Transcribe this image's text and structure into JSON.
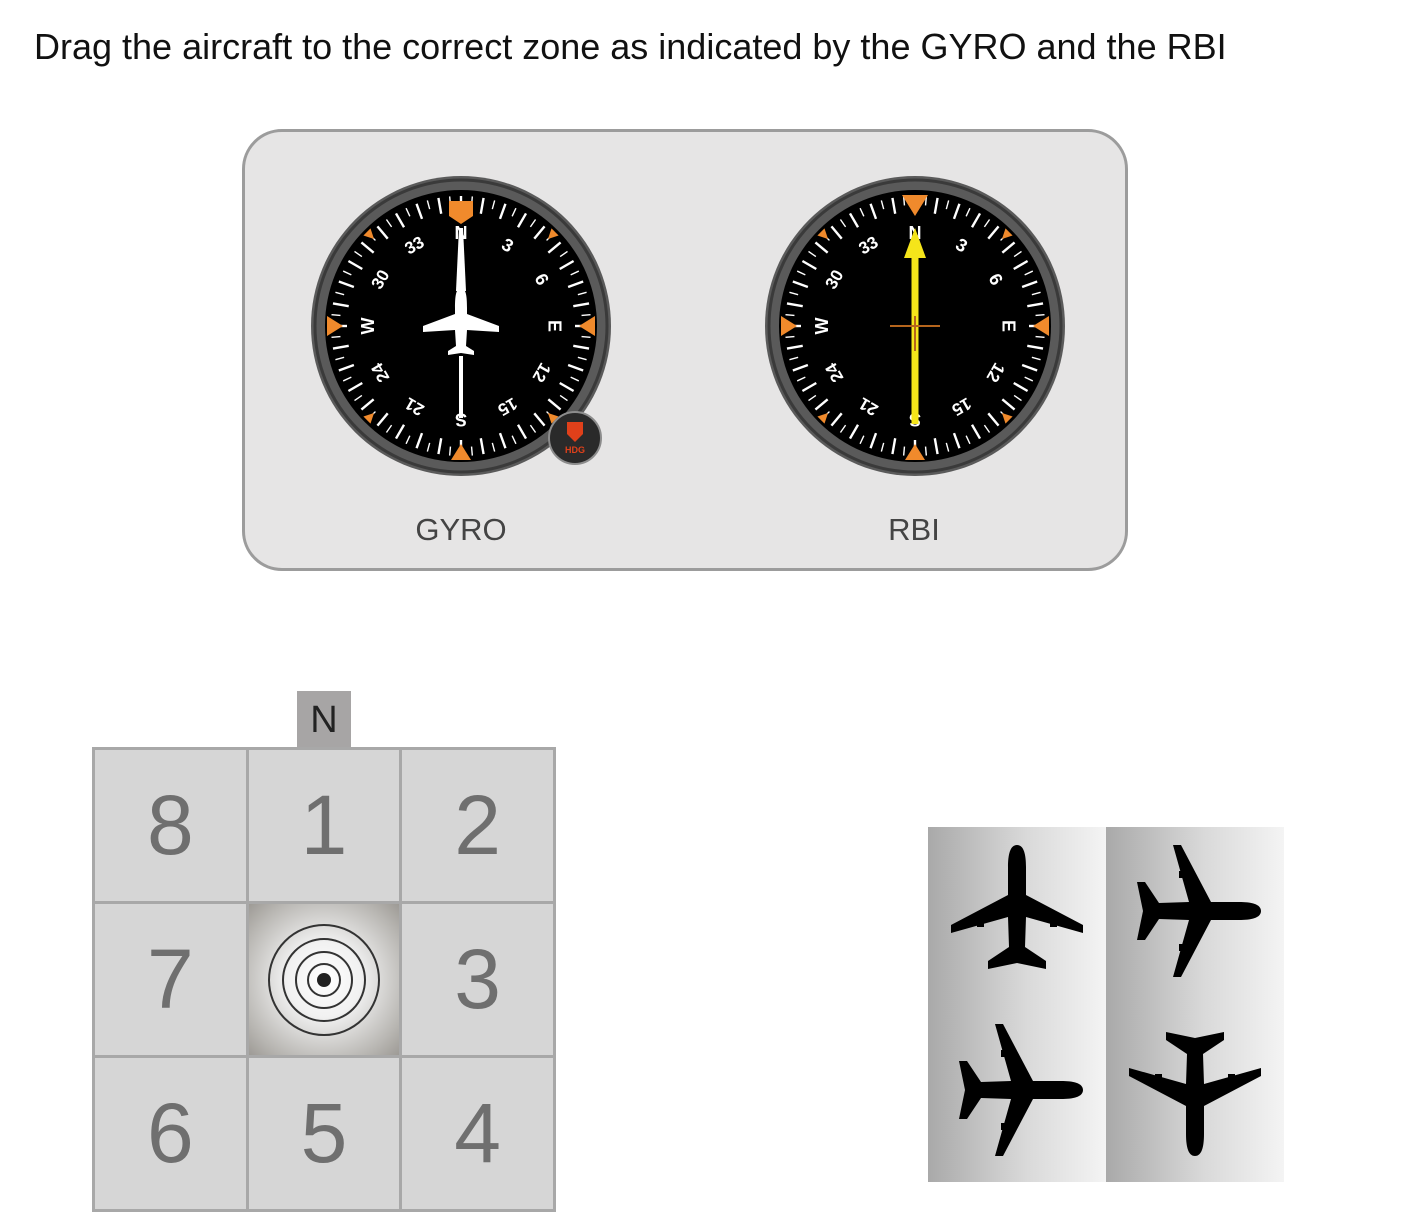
{
  "instruction": "Drag the aircraft to the correct zone as indicated by the GYRO and the RBI",
  "instruments": {
    "gyro": {
      "label": "GYRO",
      "heading_deg": 0,
      "knob_label": "HDG",
      "card_labels": [
        "N",
        "3",
        "6",
        "E",
        "12",
        "15",
        "S",
        "21",
        "24",
        "W",
        "30",
        "33"
      ]
    },
    "rbi": {
      "label": "RBI",
      "relative_bearing_deg": 0,
      "card_labels": [
        "N",
        "3",
        "6",
        "E",
        "12",
        "15",
        "S",
        "21",
        "24",
        "W",
        "30",
        "33"
      ]
    },
    "colors": {
      "face": "#000000",
      "bezel": "#5a5a5a",
      "marker": "#f08a2c",
      "needle": "#f5e51a",
      "knob": "#e0401a"
    }
  },
  "zone_grid": {
    "north_label": "N",
    "zones": [
      "8",
      "1",
      "2",
      "7",
      "",
      "3",
      "6",
      "5",
      "4"
    ],
    "center_icon": "target-icon"
  },
  "aircraft": [
    {
      "id": "aircraft-heading-north",
      "icon": "airplane-icon",
      "heading_deg": 0
    },
    {
      "id": "aircraft-heading-east",
      "icon": "airplane-icon",
      "heading_deg": 90
    },
    {
      "id": "aircraft-heading-east-2",
      "icon": "airplane-icon",
      "heading_deg": 90
    },
    {
      "id": "aircraft-heading-south",
      "icon": "airplane-icon",
      "heading_deg": 180
    }
  ]
}
